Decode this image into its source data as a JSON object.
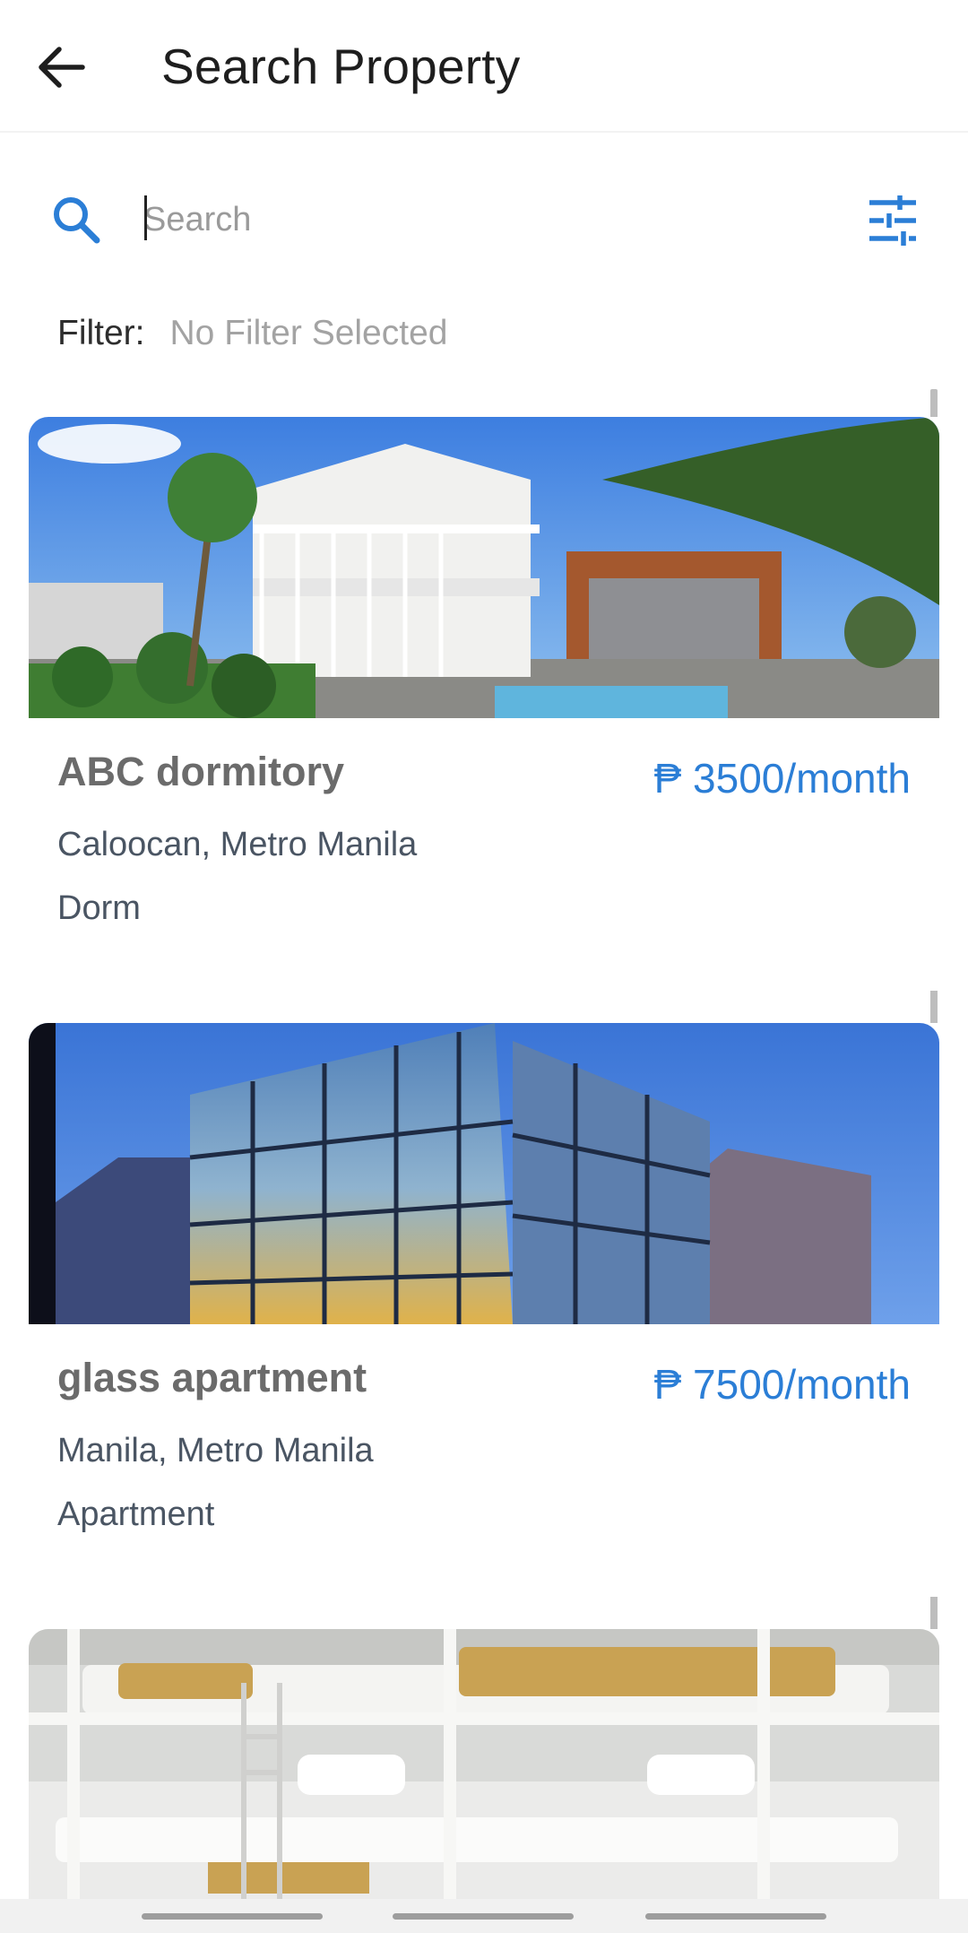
{
  "header": {
    "title": "Search Property"
  },
  "search": {
    "placeholder": "Search",
    "value": ""
  },
  "filter": {
    "label": "Filter:",
    "value": "No Filter Selected"
  },
  "colors": {
    "accent": "#2b7ed6",
    "name": "#6b6b6b",
    "meta": "#4a5563"
  },
  "icons": {
    "back": "arrow-left-icon",
    "search": "search-icon",
    "filter": "tune-icon"
  },
  "listings": [
    {
      "name": "ABC dormitory",
      "price": "₱ 3500/month",
      "location": "Caloocan, Metro Manila",
      "type": "Dorm"
    },
    {
      "name": "glass apartment",
      "price": "₱ 7500/month",
      "location": "Manila, Metro Manila",
      "type": "Apartment"
    },
    {
      "name": "",
      "price": "",
      "location": "",
      "type": ""
    }
  ]
}
